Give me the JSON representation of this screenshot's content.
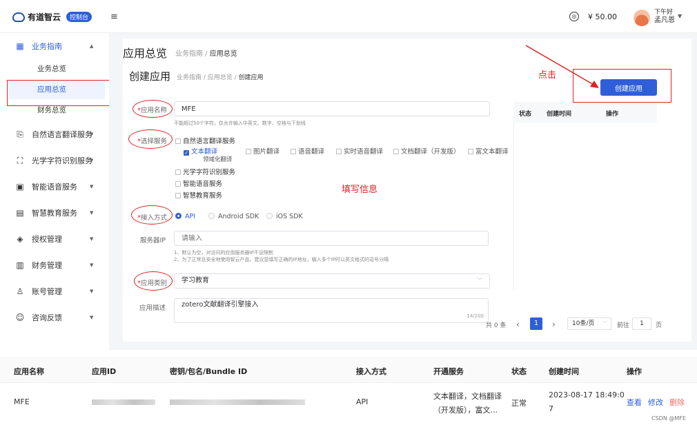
{
  "header": {
    "logo_text": "有道智云",
    "badge": "控制台",
    "fold_icon": "≡",
    "balance": "¥ 50.00",
    "greeting": "下午好",
    "username": "孟凡恩"
  },
  "sidebar": {
    "items": [
      {
        "label": "业务指南",
        "icon": "grid-icon",
        "glyph": "▦",
        "caret": "▲"
      },
      {
        "label": "自然语言翻译服务",
        "icon": "translate-icon",
        "glyph": "⎘",
        "caret": "▼"
      },
      {
        "label": "光学字符识别服务",
        "icon": "scan-icon",
        "glyph": "⛶",
        "caret": "▼"
      },
      {
        "label": "智能语音服务",
        "icon": "voice-icon",
        "glyph": "▣",
        "caret": "▼"
      },
      {
        "label": "智慧教育服务",
        "icon": "education-icon",
        "glyph": "▤",
        "caret": "▼"
      },
      {
        "label": "授权管理",
        "icon": "shield-icon",
        "glyph": "◈",
        "caret": "▼"
      },
      {
        "label": "财务管理",
        "icon": "finance-icon",
        "glyph": "▥",
        "caret": "▼"
      },
      {
        "label": "账号管理",
        "icon": "user-icon",
        "glyph": "♙",
        "caret": "▼"
      },
      {
        "label": "咨询反馈",
        "icon": "feedback-icon",
        "glyph": "☺",
        "caret": "▼"
      }
    ],
    "subitems": [
      "业务总览",
      "应用总览",
      "财务总览"
    ]
  },
  "page": {
    "title": "应用总览",
    "crumb_a": "业务指南 / ",
    "crumb_b": "应用总览"
  },
  "dialog": {
    "title": "创建应用",
    "crumb_a": "业务指南 / 应用总览 / ",
    "crumb_b": "创建应用",
    "app_name_label": "应用名称",
    "app_name_value": "MFE",
    "app_name_hint": "不能超过50个字符，仅允许输入中英文、数字、空格与下划线",
    "service_label": "选择服务",
    "service_groups": [
      "自然语言翻译服务",
      "光学字符识别服务",
      "智能语音服务",
      "智慧教育服务"
    ],
    "service_options": [
      "文本翻译",
      "图片翻译",
      "语音翻译",
      "实时语音翻译",
      "文档翻译（开发版）",
      "富文本翻译"
    ],
    "service_sub": "领域化翻译",
    "access_label": "接入方式",
    "access_options": [
      "API",
      "Android SDK",
      "iOS SDK"
    ],
    "server_ip_label": "服务器IP",
    "server_ip_placeholder": "请输入",
    "ip_hint_1": "1、默认为空，对访问的应用服务器IP不设限制",
    "ip_hint_2": "2、为了正常且安全地使用智云产品，建议您填写正确的IP地址，输入多个IP时以英文格式的逗号分隔",
    "category_label": "应用类别",
    "category_value": "学习教育",
    "desc_label": "应用描述",
    "desc_value": "zotero文献翻译引擎接入",
    "desc_count": "14/200"
  },
  "annotations": {
    "click": "点击",
    "fill": "填写信息"
  },
  "create_button": "创建应用",
  "right_table": {
    "headers": [
      "状态",
      "创建时间",
      "操作"
    ]
  },
  "pagination": {
    "total": "共 0 条",
    "prev": "‹",
    "current": "1",
    "next": "›",
    "size": "10条/页",
    "goto": "前往",
    "page": "1",
    "unit": "页"
  },
  "app_table": {
    "headers": [
      "应用名称",
      "应用ID",
      "密钥/包名/Bundle ID",
      "接入方式",
      "开通服务",
      "状态",
      "创建时间",
      "操作"
    ],
    "row": {
      "name": "MFE",
      "access": "API",
      "services_1": "文本翻译，文档翻译",
      "services_2": "（开发版），富文...",
      "status": "正常",
      "time_1": "2023-08-17 18:49:0",
      "time_2": "7",
      "actions": [
        "查看",
        "修改",
        "删除"
      ]
    }
  },
  "watermark": "CSDN @MFE",
  "colors": {
    "primary": "#2f5ed8",
    "annotation": "#e02020"
  }
}
